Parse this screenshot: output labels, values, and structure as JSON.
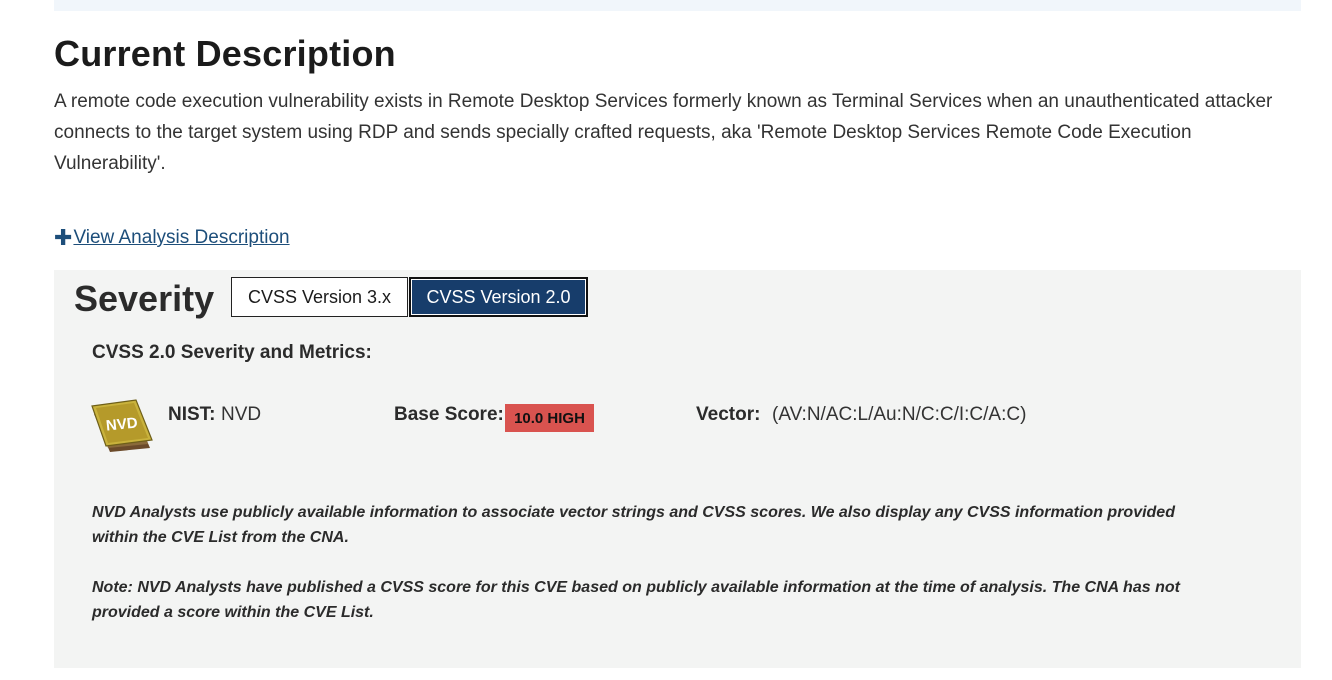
{
  "description": {
    "title": "Current Description",
    "text": "A remote code execution vulnerability exists in Remote Desktop Services formerly known as Terminal Services when an unauthenticated attacker connects to the target system using RDP and sends specially crafted requests, aka 'Remote Desktop Services Remote Code Execution Vulnerability'.",
    "analysis_link": "View Analysis Description",
    "analysis_icon": "plus-icon"
  },
  "severity": {
    "title": "Severity",
    "tabs": [
      {
        "label": "CVSS Version 3.x",
        "active": false
      },
      {
        "label": "CVSS Version 2.0",
        "active": true
      }
    ],
    "metrics_heading": "CVSS 2.0 Severity and Metrics:",
    "source_icon": "nvd-logo",
    "logo_text": "NVD",
    "nist_label": "NIST:",
    "nist_value": "NVD",
    "base_score_label": "Base Score:",
    "base_score_value": "10.0 HIGH",
    "vector_label": "Vector:",
    "vector_value": "(AV:N/AC:L/Au:N/C:C/I:C/A:C)",
    "note_1": "NVD Analysts use publicly available information to associate vector strings and CVSS scores. We also display any CVSS information provided within the CVE List from the CNA.",
    "note_2": "Note: NVD Analysts have published a CVSS score for this CVE based on publicly available information at the time of analysis. The CNA has not provided a score within the CVE List."
  },
  "colors": {
    "active_tab": "#173d6b",
    "high_badge": "#d9534f",
    "link": "#1d4e7a",
    "panel_bg": "#f3f4f3"
  }
}
